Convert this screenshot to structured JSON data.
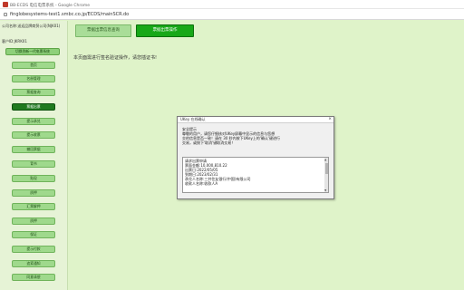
{
  "window": {
    "title": "BB-ECDS 电信电票系统 - Google Chrome"
  },
  "address": {
    "url": "finglobesystems-test1.smbc.co.jp/ECDS/mainSCR.do"
  },
  "sidebar": {
    "company": "公司名称:送迎品牌商贸公司(NJK01)",
    "user": "客户ID:JKRK01",
    "system_button": "切换到新一代电票系统",
    "items": [
      {
        "label": "首页"
      },
      {
        "label": "名册管理"
      },
      {
        "label": "票据查询"
      },
      {
        "label": "票据出票"
      },
      {
        "label": "提示承兑"
      },
      {
        "label": "提示收票"
      },
      {
        "label": "撤回票据"
      },
      {
        "label": "背书"
      },
      {
        "label": "贴现"
      },
      {
        "label": "质押"
      },
      {
        "label": "汇票解押"
      },
      {
        "label": "质押"
      },
      {
        "label": "保证"
      },
      {
        "label": "提示付款"
      },
      {
        "label": "追索通知"
      },
      {
        "label": "同意清偿"
      }
    ]
  },
  "toolbar": {
    "btn1": "票据出票信息查询",
    "btn2": "票据出票操作"
  },
  "main": {
    "notice": "本页面需进行签名验证操作，请您插证书!"
  },
  "dialog": {
    "title": "UKey 在线确认",
    "close": "×",
    "hint_lines": [
      "安全提示",
      "尊敬的用户，请您仔细核对UKey屏幕中显示的信息与您想",
      "交的信息是否一致！请在 30 秒内按下UKey上的'确认'键进行",
      "交易，或按下'取消'键取消交易！"
    ],
    "detail_lines": [
      "请求出票申请",
      "票面金额:10,000,810.22",
      "出票日:2022/05/05",
      "到期日:2023/02/31",
      "承兑人名称:三井住友银行(中国)有限公司",
      "收款人名称:收款人A"
    ],
    "scroll_up": "▲",
    "scroll_down": "▼"
  }
}
